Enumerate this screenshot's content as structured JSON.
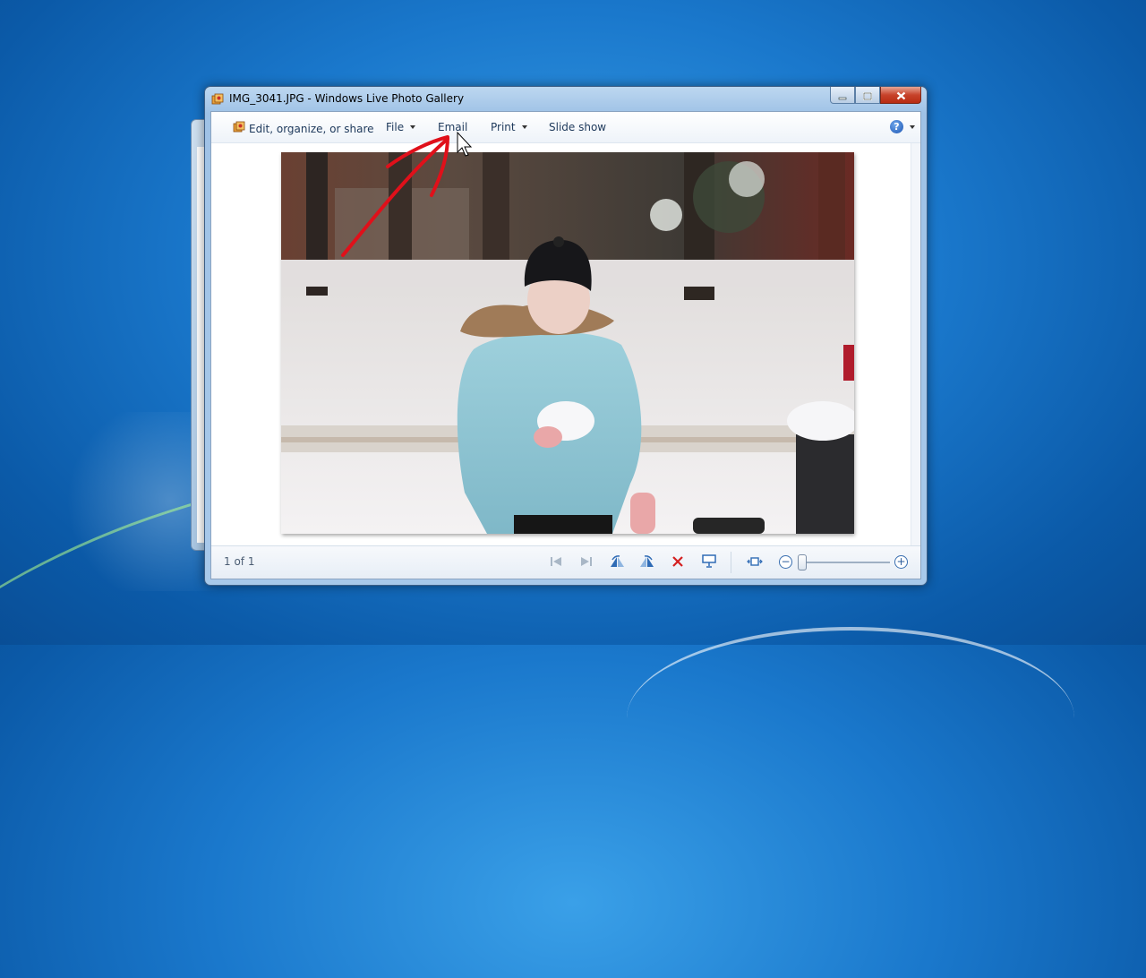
{
  "window": {
    "title": "IMG_3041.JPG - Windows Live Photo Gallery"
  },
  "toolbar": {
    "edit_label": "Edit, organize, or share",
    "file_label": "File",
    "email_label": "Email",
    "print_label": "Print",
    "slideshow_label": "Slide show",
    "help_glyph": "?"
  },
  "status": {
    "page_count": "1 of 1"
  },
  "icons": {
    "app": "photo-gallery-icon",
    "minimize": "minimize-icon",
    "maximize": "maximize-icon",
    "close": "close-icon",
    "help": "help-icon",
    "previous": "previous-icon",
    "next": "next-icon",
    "rotate_left": "rotate-left-icon",
    "rotate_right": "rotate-right-icon",
    "delete": "delete-icon",
    "slideshow": "slideshow-icon",
    "actual_size": "actual-size-icon",
    "zoom_out": "zoom-out-icon",
    "zoom_in": "zoom-in-icon"
  },
  "zoom": {
    "level": 0
  },
  "colors": {
    "annotation_arrow": "#e0101a",
    "delete_icon": "#d42020",
    "toolbar_text": "#1e395b"
  }
}
